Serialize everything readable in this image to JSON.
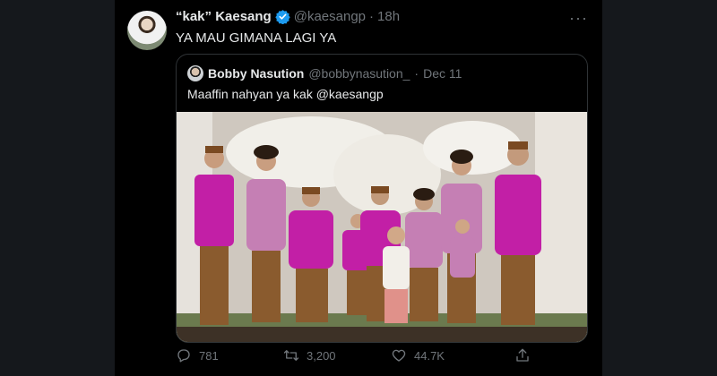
{
  "tweet": {
    "display_name": "“kak” Kaesang",
    "handle": "@kaesangp",
    "separator": "·",
    "time": "18h",
    "more_label": "···",
    "text": "YA MAU GIMANA LAGI YA"
  },
  "quote": {
    "display_name": "Bobby Nasution",
    "handle": "@bobbynasution_",
    "separator": "·",
    "date": "Dec 11",
    "text": "Maaffin nahyan ya kak @kaesangp"
  },
  "actions": {
    "reply_count": "781",
    "retweet_count": "3,200",
    "like_count": "44.7K"
  },
  "icons": {
    "verified": "verified-badge-icon",
    "more": "more-options-icon",
    "reply": "reply-icon",
    "retweet": "retweet-icon",
    "like": "like-icon",
    "share": "share-icon"
  },
  "colors": {
    "background": "#000000",
    "side_panel": "#15181c",
    "verified": "#1d9bf0",
    "muted": "#71767b",
    "magenta": "#c21fa6"
  }
}
